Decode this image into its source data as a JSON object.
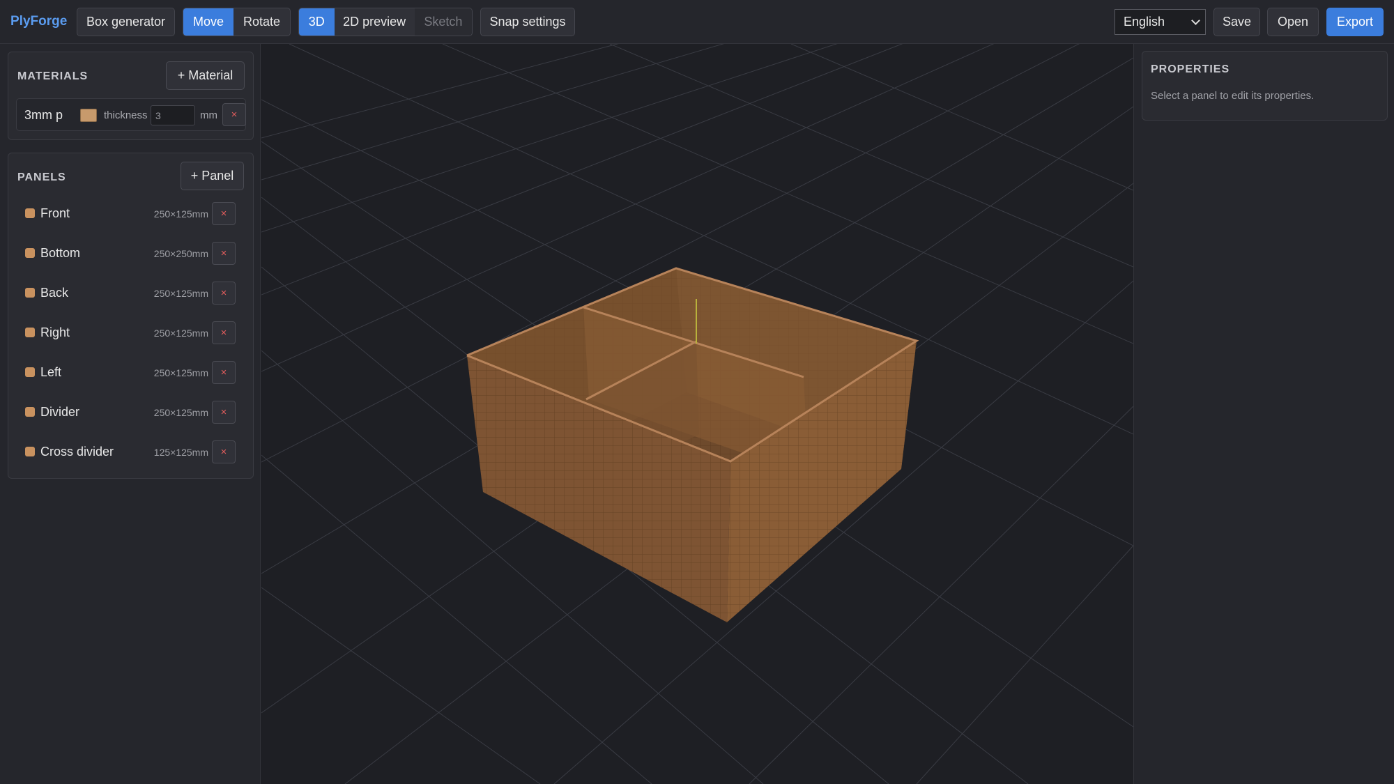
{
  "app": {
    "name": "PlyForge"
  },
  "toolbar": {
    "box_generator": "Box generator",
    "tool_modes": [
      {
        "label": "Move",
        "active": true
      },
      {
        "label": "Rotate",
        "active": false
      }
    ],
    "view_modes": [
      {
        "label": "3D",
        "active": true
      },
      {
        "label": "2D preview",
        "active": false
      },
      {
        "label": "Sketch",
        "active": false,
        "disabled": true
      }
    ],
    "snap_settings": "Snap settings",
    "language": "English",
    "save": "Save",
    "open": "Open",
    "export": "Export"
  },
  "materials": {
    "title": "MATERIALS",
    "add_label": "+ Material",
    "items": [
      {
        "name": "3mm p",
        "color": "#c79a6c",
        "thickness_label": "thickness",
        "thickness": "3",
        "unit": "mm",
        "remove": "×"
      }
    ]
  },
  "panels": {
    "title": "PANELS",
    "add_label": "+ Panel",
    "items": [
      {
        "name": "Front",
        "dims": "250×125mm",
        "remove": "×"
      },
      {
        "name": "Bottom",
        "dims": "250×250mm",
        "remove": "×"
      },
      {
        "name": "Back",
        "dims": "250×125mm",
        "remove": "×"
      },
      {
        "name": "Right",
        "dims": "250×125mm",
        "remove": "×"
      },
      {
        "name": "Left",
        "dims": "250×125mm",
        "remove": "×"
      },
      {
        "name": "Divider",
        "dims": "250×125mm",
        "remove": "×"
      },
      {
        "name": "Cross divider",
        "dims": "125×125mm",
        "remove": "×"
      }
    ]
  },
  "properties": {
    "title": "PROPERTIES",
    "hint": "Select a panel to edit its properties."
  },
  "colors": {
    "accent": "#3b7ddd",
    "brand": "#5b9cf0",
    "plywood": "#c79a6c",
    "danger": "#e35d5d"
  }
}
